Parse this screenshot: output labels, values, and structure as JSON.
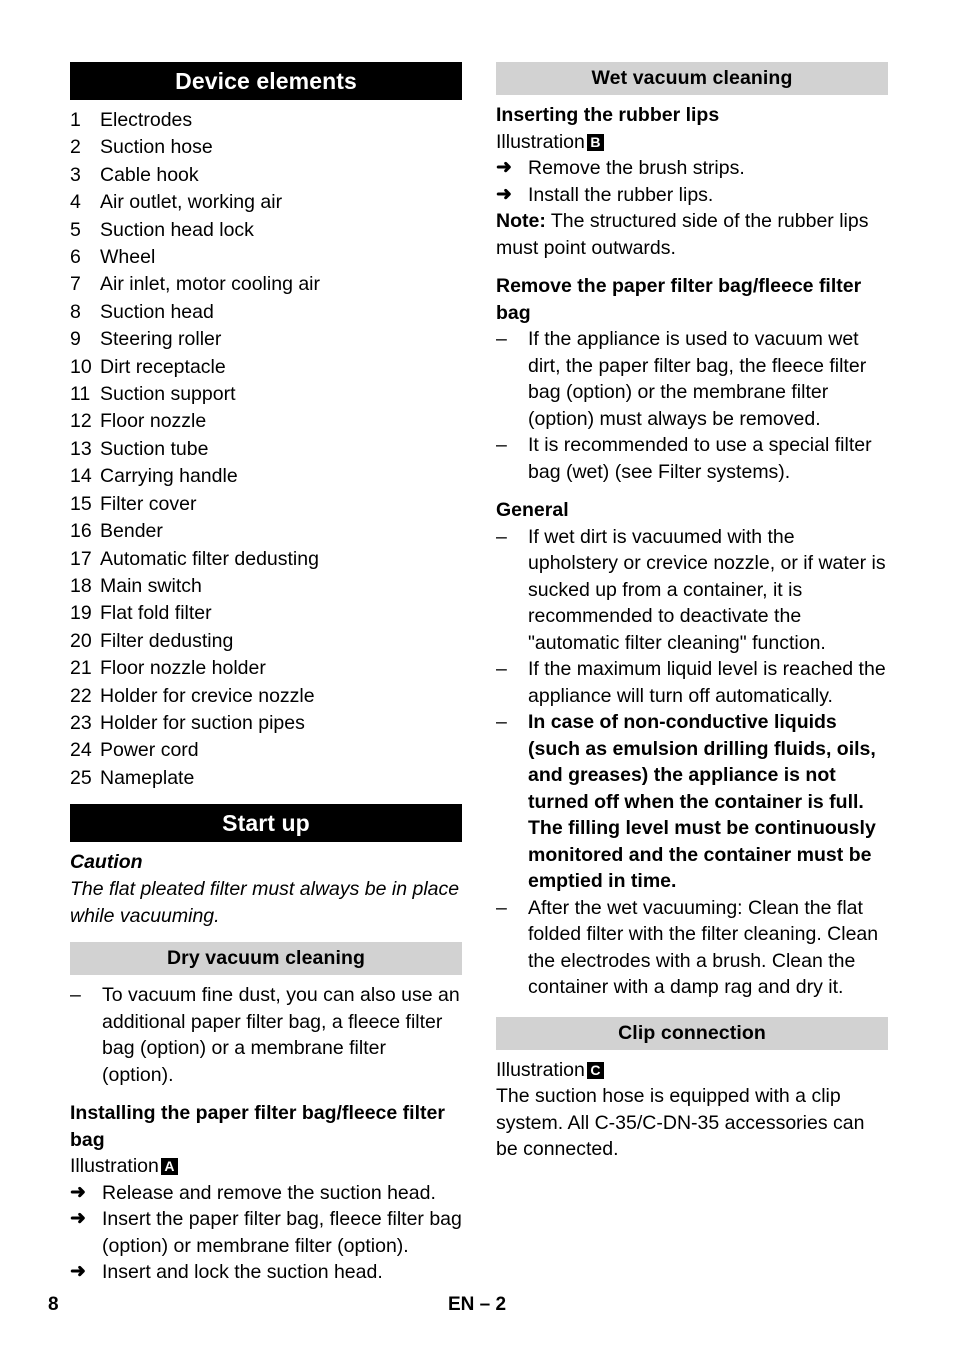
{
  "document": {
    "footer": {
      "page_number": "8",
      "language_page": "EN – 2"
    },
    "colors": {
      "section_bar_primary_bg": "#000000",
      "section_bar_primary_text": "#ffffff",
      "section_bar_secondary_bg": "#d2d2d2",
      "section_bar_secondary_text": "#000000",
      "page_bg": "#ffffff",
      "body_text": "#000000"
    }
  },
  "left_column": {
    "device_elements": {
      "heading": "Device elements",
      "items": [
        {
          "num": "1",
          "label": "Electrodes"
        },
        {
          "num": "2",
          "label": "Suction hose"
        },
        {
          "num": "3",
          "label": "Cable hook"
        },
        {
          "num": "4",
          "label": "Air outlet, working air"
        },
        {
          "num": "5",
          "label": "Suction head lock"
        },
        {
          "num": "6",
          "label": "Wheel"
        },
        {
          "num": "7",
          "label": "Air inlet, motor cooling air"
        },
        {
          "num": "8",
          "label": "Suction head"
        },
        {
          "num": "9",
          "label": "Steering roller"
        },
        {
          "num": "10",
          "label": "Dirt receptacle"
        },
        {
          "num": "11",
          "label": "Suction support"
        },
        {
          "num": "12",
          "label": "Floor nozzle"
        },
        {
          "num": "13",
          "label": "Suction tube"
        },
        {
          "num": "14",
          "label": "Carrying handle"
        },
        {
          "num": "15",
          "label": "Filter cover"
        },
        {
          "num": "16",
          "label": "Bender"
        },
        {
          "num": "17",
          "label": "Automatic filter dedusting"
        },
        {
          "num": "18",
          "label": "Main switch"
        },
        {
          "num": "19",
          "label": "Flat fold filter"
        },
        {
          "num": "20",
          "label": "Filter dedusting"
        },
        {
          "num": "21",
          "label": "Floor nozzle holder"
        },
        {
          "num": "22",
          "label": "Holder for crevice nozzle"
        },
        {
          "num": "23",
          "label": "Holder for suction pipes"
        },
        {
          "num": "24",
          "label": "Power cord"
        },
        {
          "num": "25",
          "label": "Nameplate"
        }
      ]
    },
    "start_up": {
      "heading": "Start up",
      "caution_title": "Caution",
      "caution_text": "The flat pleated filter must always be in place while vacuuming."
    },
    "dry_vacuum_cleaning": {
      "heading": "Dry vacuum cleaning",
      "bullets": [
        {
          "mark": "–",
          "text": "To vacuum fine dust, you can also use an additional paper filter bag, a fleece filter bag (option) or a membrane filter (option)."
        }
      ],
      "subheading": "Installing the paper filter bag/fleece filter bag",
      "illustration_label": "Illustration",
      "illustration_ref": "A",
      "steps": [
        {
          "mark": "➜",
          "text": "Release and remove the suction head."
        },
        {
          "mark": "➜",
          "text": "Insert the paper filter bag, fleece filter bag (option) or membrane filter (option)."
        },
        {
          "mark": "➜",
          "text": "Insert and lock the suction head."
        }
      ]
    }
  },
  "right_column": {
    "wet_vacuum_cleaning": {
      "heading": "Wet vacuum cleaning",
      "inserting_rubber_lips": {
        "subheading": "Inserting the rubber lips",
        "illustration_label": "Illustration",
        "illustration_ref": "B",
        "steps": [
          {
            "mark": "➜",
            "text": "Remove the brush strips."
          },
          {
            "mark": "➜",
            "text": "Install the rubber lips."
          }
        ],
        "note_label": "Note:",
        "note_text": " The structured side of the rubber lips must point outwards."
      },
      "remove_filter_bag": {
        "subheading": "Remove the paper filter bag/fleece filter bag",
        "bullets": [
          {
            "mark": "–",
            "text": "If the appliance is used to vacuum wet dirt, the paper filter bag, the fleece filter bag (option) or the membrane filter (option) must always be removed."
          },
          {
            "mark": "–",
            "text": "It is recommended to use a special filter bag (wet) (see Filter systems)."
          }
        ]
      },
      "general": {
        "subheading": "General",
        "bullets": [
          {
            "mark": "–",
            "bold": false,
            "text": "If wet dirt is vacuumed with the upholstery or crevice nozzle, or if water is sucked up from a container, it is recommended to deactivate the \"automatic filter cleaning\" function."
          },
          {
            "mark": "–",
            "bold": false,
            "text": "If the maximum liquid level is reached the appliance will turn off automatically."
          },
          {
            "mark": "–",
            "bold": true,
            "text": "In case of non-conductive liquids (such as emulsion drilling fluids, oils, and greases) the appliance is not turned off when the container is full. The filling level must be continuously monitored and the container must be emptied in time."
          },
          {
            "mark": "–",
            "bold": false,
            "text": "After the wet vacuuming: Clean the flat folded filter with the filter cleaning. Clean the electrodes with a brush. Clean the container with a damp rag and dry it."
          }
        ]
      }
    },
    "clip_connection": {
      "heading": "Clip connection",
      "illustration_label": "Illustration",
      "illustration_ref": "C",
      "text": "The suction hose is equipped with a clip system. All C-35/C-DN-35 accessories can be connected."
    }
  }
}
